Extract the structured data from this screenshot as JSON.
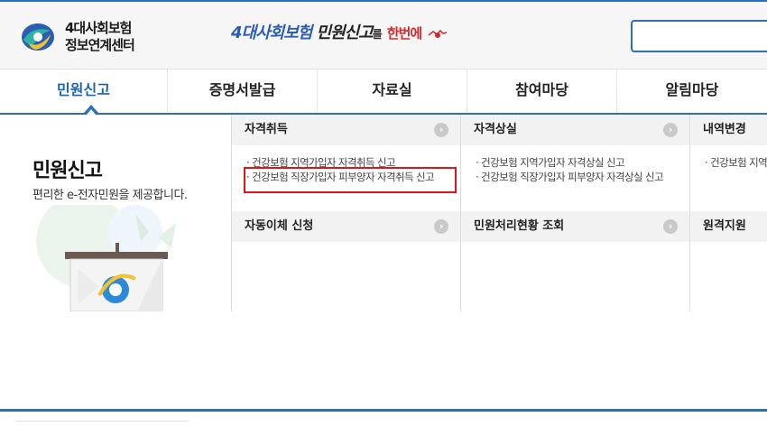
{
  "header": {
    "logo_line1": "4대사회보험",
    "logo_line2": "정보연계센터",
    "banner": {
      "part1": "4대사회보험",
      "part2": "민원신고",
      "part3": "를",
      "part4": "한번에"
    },
    "search_placeholder": ""
  },
  "gnb": {
    "items": [
      {
        "label": "민원신고",
        "active": true
      },
      {
        "label": "증명서발급"
      },
      {
        "label": "자료실"
      },
      {
        "label": "참여마당"
      },
      {
        "label": "알림마당"
      }
    ]
  },
  "panel": {
    "title": "민원신고",
    "description": "편리한 e-전자민원을 제공합니다.",
    "columns": [
      {
        "top": {
          "heading": "자격취득",
          "items": [
            "건강보험 지역가입자 자격취득 신고",
            "건강보험 직장가입자 피부양자 자격취득 신고"
          ]
        },
        "bottom": {
          "heading": "자동이체 신청",
          "items": []
        }
      },
      {
        "top": {
          "heading": "자격상실",
          "items": [
            "건강보험 지역가입자 자격상실 신고",
            "건강보험 직장가입자 피부양자 자격상실 신고"
          ]
        },
        "bottom": {
          "heading": "민원처리현황 조회",
          "items": []
        }
      },
      {
        "top": {
          "heading": "내역변경",
          "items": [
            "건강보험 지역가"
          ]
        },
        "bottom": {
          "heading": "원격지원",
          "items": []
        }
      }
    ]
  },
  "colors": {
    "accent": "#2f6fb3",
    "active_nav": "#1c63b0",
    "highlight": "#e0141d",
    "section_bg": "#f2f2f2"
  }
}
